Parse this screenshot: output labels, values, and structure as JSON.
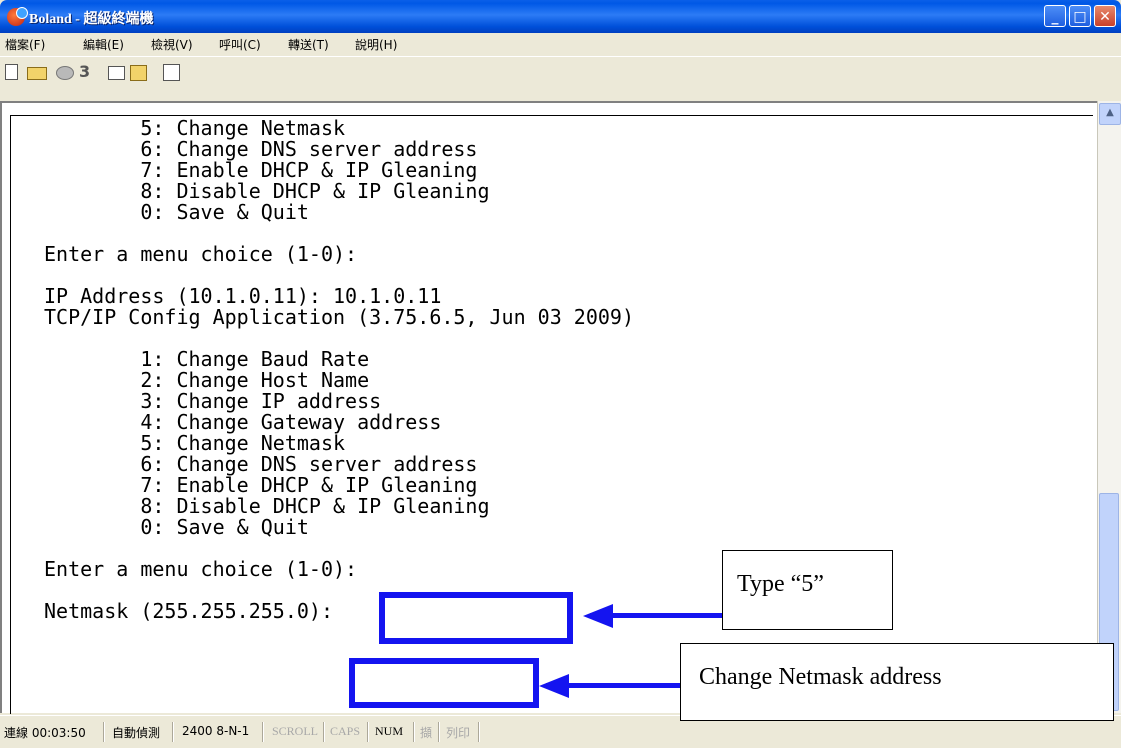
{
  "window": {
    "title": "Boland - 超級終端機",
    "controls": [
      "minimize",
      "maximize",
      "close"
    ]
  },
  "menu": [
    "檔案(F)",
    "編輯(E)",
    "檢視(V)",
    "呼叫(C)",
    "轉送(T)",
    "說明(H)"
  ],
  "toolbar": [
    "new-icon",
    "open-icon",
    "connect-icon",
    "disconnect-icon",
    "send-icon",
    "receive-icon",
    "properties-icon"
  ],
  "terminal": {
    "lines": [
      "        5: Change Netmask",
      "        6: Change DNS server address",
      "        7: Enable DHCP & IP Gleaning",
      "        8: Disable DHCP & IP Gleaning",
      "        0: Save & Quit",
      "",
      "Enter a menu choice (1-0):",
      "",
      "IP Address (10.1.0.11): 10.1.0.11",
      "TCP/IP Config Application (3.75.6.5, Jun 03 2009)",
      "",
      "        1: Change Baud Rate",
      "        2: Change Host Name",
      "        3: Change IP address",
      "        4: Change Gateway address",
      "        5: Change Netmask",
      "        6: Change DNS server address",
      "        7: Enable DHCP & IP Gleaning",
      "        8: Disable DHCP & IP Gleaning",
      "        0: Save & Quit",
      "",
      "Enter a menu choice (1-0):",
      "",
      "Netmask (255.255.255.0):"
    ]
  },
  "status_bar": {
    "connected_time": "連線 00:03:50",
    "detect": "自動偵測",
    "settings": "2400 8-N-1",
    "scroll": "SCROLL",
    "caps": "CAPS",
    "num": "NUM",
    "capture": "擷",
    "print": "列印"
  },
  "annotations": {
    "callout_1": "Type “5”",
    "callout_2": "Change Netmask address"
  },
  "colors": {
    "titlebar": "#0058E6",
    "highlight": "#1414F0",
    "scroll_thumb": "#C1D3FB"
  }
}
